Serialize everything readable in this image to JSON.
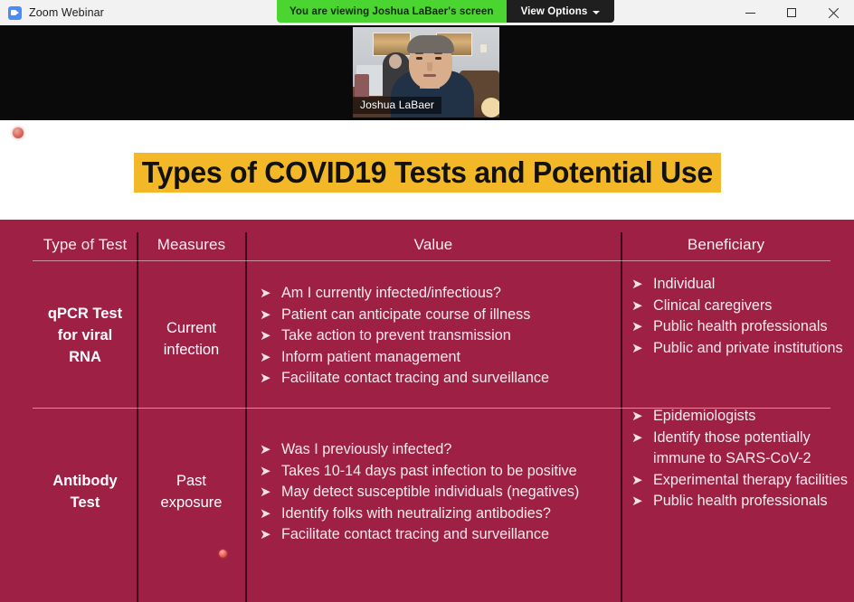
{
  "window": {
    "app_title": "Zoom Webinar",
    "logo_icon": "zoom-camera-icon",
    "controls": {
      "minimize": "minimize-icon",
      "maximize": "maximize-icon",
      "close": "close-icon"
    }
  },
  "share_banner": {
    "viewing_text": "You are viewing Joshua LaBaer's screen",
    "view_options_label": "View Options",
    "caret_icon": "chevron-down-icon",
    "green": "#4ad530",
    "dark": "#1f1f1f"
  },
  "video": {
    "participant_name": "Joshua LaBaer",
    "fullscreen_icon": "fullscreen-icon"
  },
  "slide": {
    "title": "Types of COVID19 Tests and Potential Use",
    "title_highlight_color": "#f2b828",
    "table_background": "#9e2045",
    "table": {
      "headers": [
        "Type of Test",
        "Measures",
        "Value",
        "Beneficiary"
      ],
      "rows": [
        {
          "type_of_test": "qPCR Test for viral RNA",
          "type_of_test_lines": [
            "qPCR Test",
            "for viral",
            "RNA"
          ],
          "measures_lines": [
            "Current",
            "infection"
          ],
          "value": [
            "Am I currently infected/infectious?",
            "Patient can anticipate course of illness",
            "Take action to prevent transmission",
            "Inform patient management",
            "Facilitate contact tracing and surveillance"
          ],
          "beneficiary": [
            "Individual",
            "Clinical caregivers",
            "Public health professionals",
            "Public and private institutions"
          ]
        },
        {
          "type_of_test": "Antibody Test",
          "type_of_test_lines": [
            "Antibody",
            "Test"
          ],
          "measures_lines": [
            "Past",
            "exposure"
          ],
          "value": [
            "Was I previously infected?",
            "Takes 10-14 days past infection to be positive",
            "May detect susceptible individuals (negatives)",
            "Identify folks with neutralizing antibodies?",
            "Facilitate contact tracing and surveillance"
          ],
          "beneficiary": [
            "Epidemiologists",
            "Identify those potentially immune to SARS-CoV-2",
            "Experimental therapy facilities",
            "Public health professionals"
          ]
        }
      ]
    },
    "bullet_glyph": "➤"
  }
}
